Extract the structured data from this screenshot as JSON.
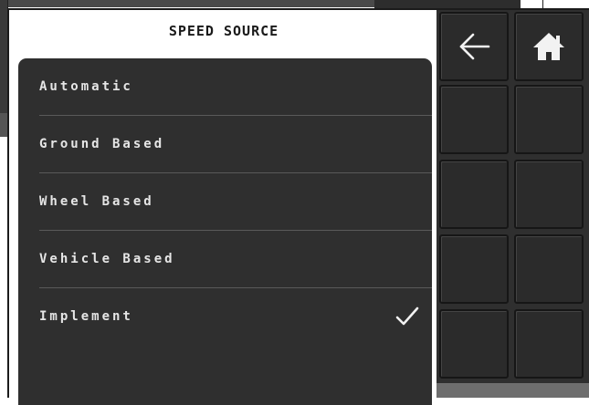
{
  "dialog": {
    "title": "SPEED SOURCE",
    "options": [
      {
        "label": "Automatic",
        "selected": false
      },
      {
        "label": "Ground Based",
        "selected": false
      },
      {
        "label": "Wheel Based",
        "selected": false
      },
      {
        "label": "Vehicle Based",
        "selected": false
      },
      {
        "label": "Implement",
        "selected": true
      }
    ]
  },
  "toolbar": {
    "back_icon": "arrow-left-icon",
    "home_icon": "home-icon"
  },
  "colors": {
    "panel": "#2f2f2f",
    "text": "#e6e6e6",
    "divider": "#5a5a5a"
  }
}
